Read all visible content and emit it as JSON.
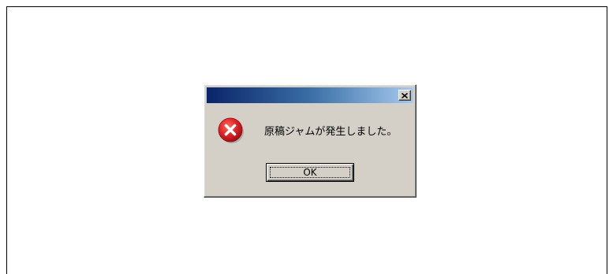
{
  "dialog": {
    "message": "原稿ジャムが発生しました。",
    "ok_label": "OK",
    "icon": "error-icon",
    "close_icon": "close-icon"
  },
  "colors": {
    "dialog_face": "#d4d0c8",
    "titlebar_start": "#0a246a",
    "titlebar_end": "#a6caf0",
    "error_red": "#e0262a"
  }
}
